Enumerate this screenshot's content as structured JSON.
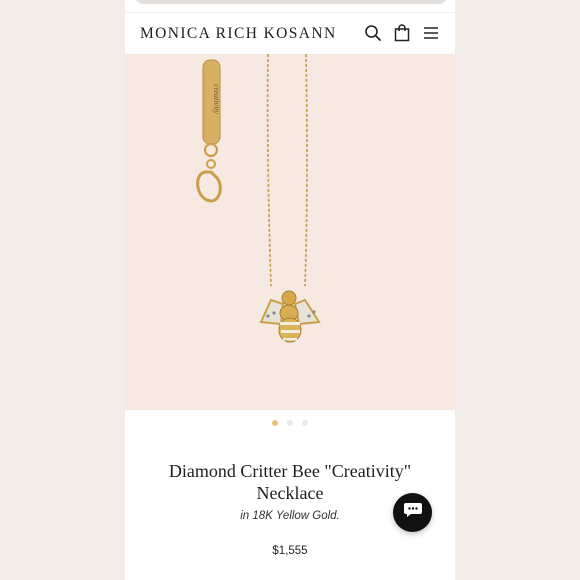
{
  "header": {
    "brand": "MONICA RICH KOSANN",
    "icons": [
      "search-icon",
      "shopping-bag-icon",
      "hamburger-menu-icon"
    ]
  },
  "product": {
    "title_line1": "Diamond Critter Bee \"Creativity\"",
    "title_line2": "Necklace",
    "subtitle": "in 18K Yellow Gold.",
    "price": "$1,555",
    "tag_engraving": "creativity"
  },
  "carousel": {
    "total_slides": 3,
    "active_index": 0
  },
  "chat": {
    "icon": "chat-bubble-icon"
  },
  "colors": {
    "hero_bg": "#f6e9e1",
    "gold": "#c9a04a",
    "active_dot": "#e8c173",
    "chat_bg": "#111111"
  }
}
